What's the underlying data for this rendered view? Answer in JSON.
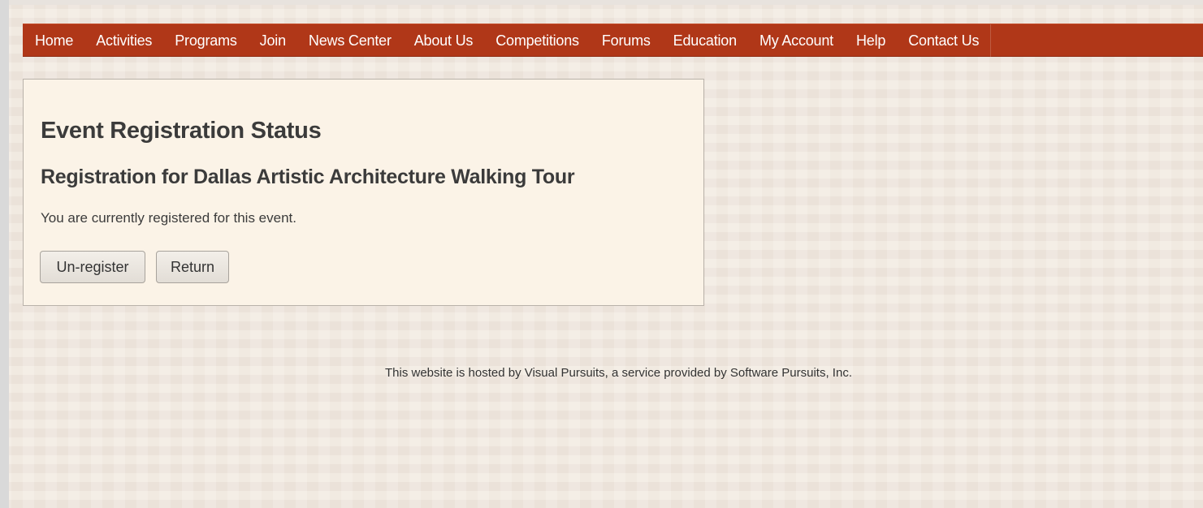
{
  "nav": {
    "items": [
      {
        "label": "Home"
      },
      {
        "label": "Activities"
      },
      {
        "label": "Programs"
      },
      {
        "label": "Join"
      },
      {
        "label": "News Center"
      },
      {
        "label": "About Us"
      },
      {
        "label": "Competitions"
      },
      {
        "label": "Forums"
      },
      {
        "label": "Education"
      },
      {
        "label": "My Account"
      },
      {
        "label": "Help"
      },
      {
        "label": "Contact Us"
      }
    ]
  },
  "panel": {
    "title": "Event Registration Status",
    "subtitle": "Registration for Dallas Artistic Architecture Walking Tour",
    "message": "You are currently registered for this event.",
    "unregister_label": "Un-register",
    "return_label": "Return"
  },
  "footer": {
    "text": "This website is hosted by Visual Pursuits, a service provided by Software Pursuits, Inc."
  },
  "colors": {
    "nav_bg": "#b03718",
    "page_bg": "#efe6dc",
    "panel_bg": "#fbf3e7",
    "text": "#3b3b3b"
  }
}
